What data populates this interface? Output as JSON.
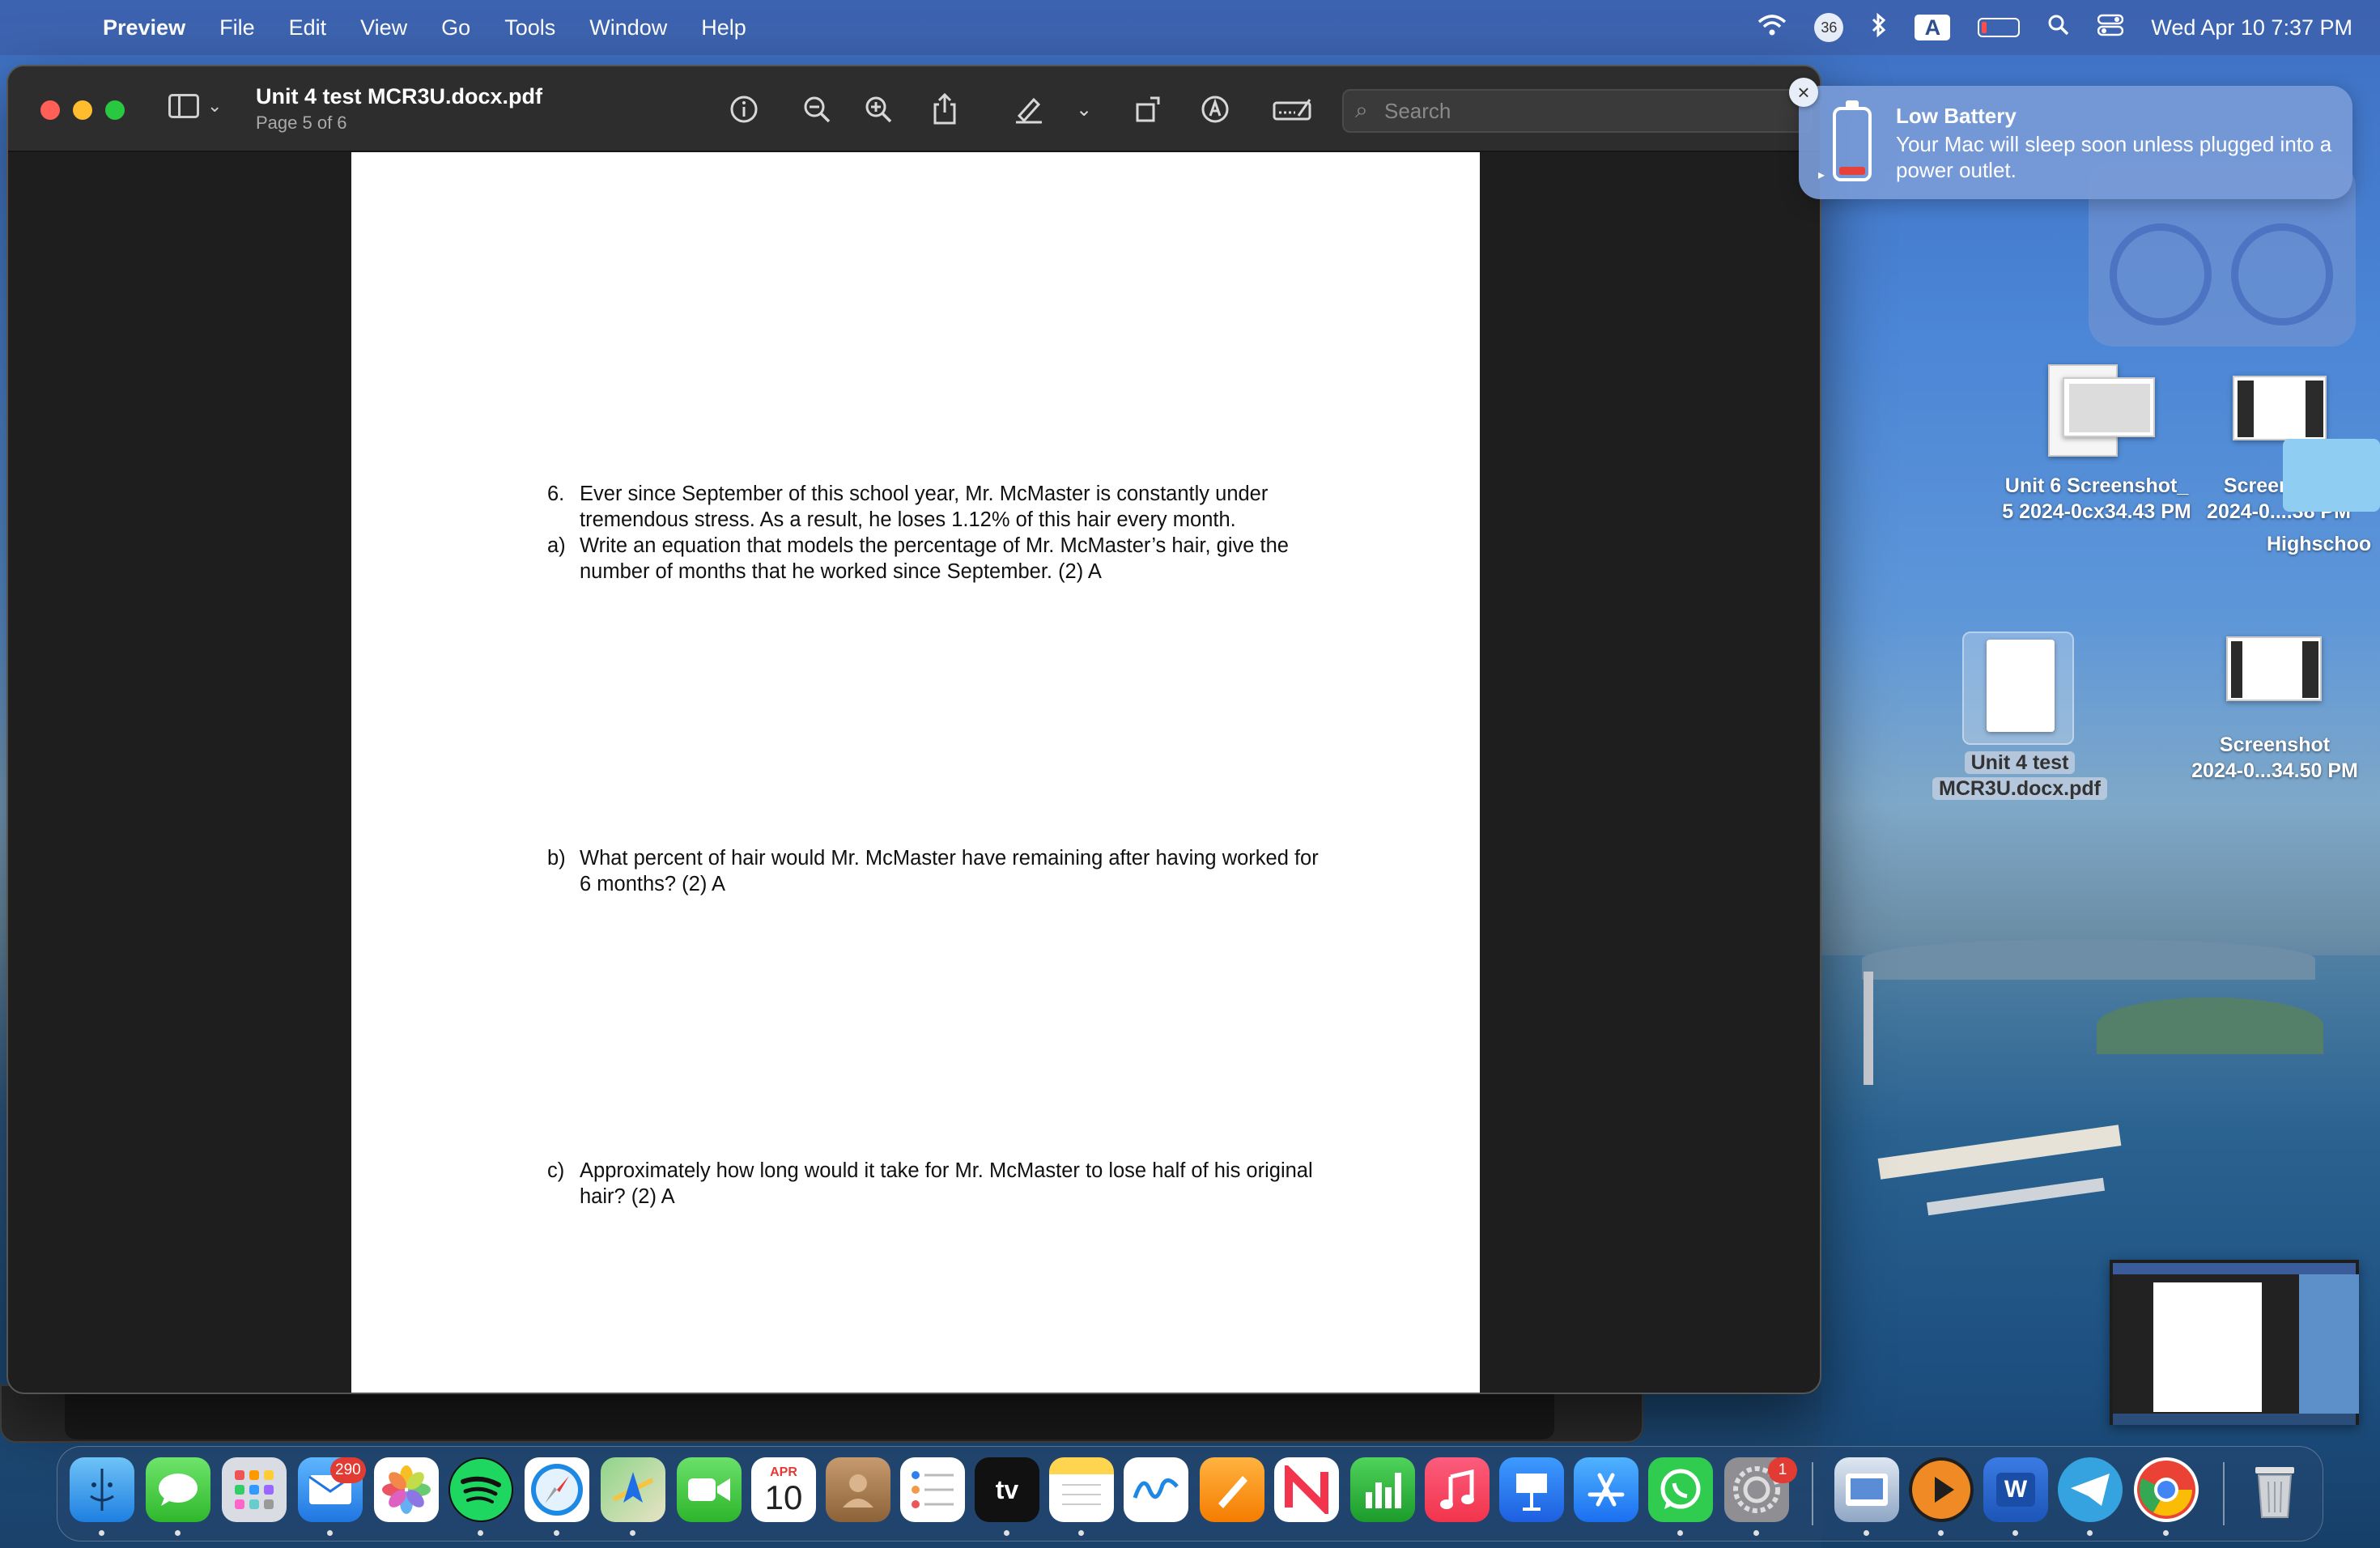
{
  "menubar": {
    "app_name": "Preview",
    "items": [
      "File",
      "Edit",
      "View",
      "Go",
      "Tools",
      "Window",
      "Help"
    ],
    "status_badge": "36",
    "input_source": "A",
    "datetime": "Wed Apr 10  7:37 PM"
  },
  "window": {
    "title": "Unit 4 test  MCR3U.docx.pdf",
    "subtitle": "Page 5 of 6",
    "search_placeholder": "Search"
  },
  "document": {
    "q6_num": "6.",
    "q6_text": "Ever since September of this school year, Mr. McMaster is constantly under tremendous stress. As a result, he loses 1.12% of this hair every month.",
    "qa_num": "a)",
    "qa_text": "Write an equation that models the percentage of Mr. McMaster’s hair, give the number of months that he worked since September. (2) A",
    "qb_num": "b)",
    "qb_text": "What percent of hair would Mr. McMaster have remaining after having worked for 6 months? (2) A",
    "qc_num": "c)",
    "qc_text": "Approximately how long would it take for Mr. McMaster to lose half of his original hair? (2) A"
  },
  "notification": {
    "title": "Low Battery",
    "body": "Your Mac will sleep soon unless plugged into a power outlet."
  },
  "desktop": {
    "icon1_label_a": "Unit 6 Screenshot_",
    "icon1_label_b": "5 2024-0cx34.43 PM",
    "icon2_label_a": "Screenshot",
    "icon2_label_b": "2024-0....38 PM",
    "folder_label": "Highschoo",
    "icon3_label_a": "Unit 4 test",
    "icon3_label_b": "MCR3U.docx.pdf",
    "icon4_label_a": "Screenshot",
    "icon4_label_b": "2024-0...34.50 PM"
  },
  "dock": {
    "mail_badge": "290",
    "calendar_month": "APR",
    "calendar_day": "10",
    "tv_label": "tv",
    "settings_badge": "1",
    "word_label": "W"
  },
  "colors": {
    "close": "#ff5f57",
    "minimize": "#febc2e",
    "zoom": "#28c840",
    "badge_red": "#e23b33"
  }
}
